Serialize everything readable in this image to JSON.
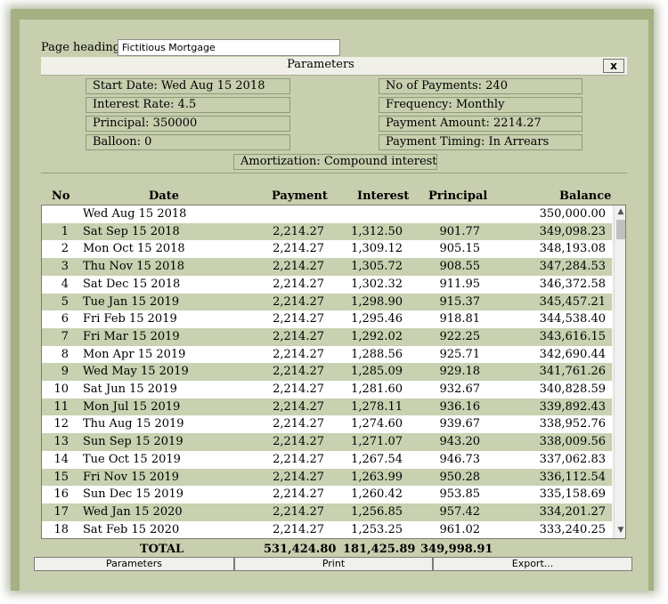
{
  "heading": {
    "label": "Page heading:",
    "value": "Fictitious Mortgage"
  },
  "parameters": {
    "title": "Parameters",
    "close_label": "x",
    "start_date": "Start Date: Wed Aug 15 2018",
    "interest_rate": "Interest Rate: 4.5",
    "principal": "Principal: 350000",
    "balloon": "Balloon: 0",
    "num_payments": "No of Payments: 240",
    "frequency": "Frequency: Monthly",
    "payment_amount": "Payment Amount: 2214.27",
    "payment_timing": "Payment Timing: In Arrears",
    "amortization": "Amortization: Compound interest"
  },
  "table": {
    "headers": {
      "no": "No",
      "date": "Date",
      "payment": "Payment",
      "interest": "Interest",
      "principal": "Principal",
      "balance": "Balance"
    },
    "rows": [
      {
        "no": "",
        "date": "Wed Aug 15 2018",
        "payment": "",
        "interest": "",
        "principal": "",
        "balance": "350,000.00"
      },
      {
        "no": "1",
        "date": "Sat Sep 15 2018",
        "payment": "2,214.27",
        "interest": "1,312.50",
        "principal": "901.77",
        "balance": "349,098.23"
      },
      {
        "no": "2",
        "date": "Mon Oct 15 2018",
        "payment": "2,214.27",
        "interest": "1,309.12",
        "principal": "905.15",
        "balance": "348,193.08"
      },
      {
        "no": "3",
        "date": "Thu Nov 15 2018",
        "payment": "2,214.27",
        "interest": "1,305.72",
        "principal": "908.55",
        "balance": "347,284.53"
      },
      {
        "no": "4",
        "date": "Sat Dec 15 2018",
        "payment": "2,214.27",
        "interest": "1,302.32",
        "principal": "911.95",
        "balance": "346,372.58"
      },
      {
        "no": "5",
        "date": "Tue Jan 15 2019",
        "payment": "2,214.27",
        "interest": "1,298.90",
        "principal": "915.37",
        "balance": "345,457.21"
      },
      {
        "no": "6",
        "date": "Fri Feb 15 2019",
        "payment": "2,214.27",
        "interest": "1,295.46",
        "principal": "918.81",
        "balance": "344,538.40"
      },
      {
        "no": "7",
        "date": "Fri Mar 15 2019",
        "payment": "2,214.27",
        "interest": "1,292.02",
        "principal": "922.25",
        "balance": "343,616.15"
      },
      {
        "no": "8",
        "date": "Mon Apr 15 2019",
        "payment": "2,214.27",
        "interest": "1,288.56",
        "principal": "925.71",
        "balance": "342,690.44"
      },
      {
        "no": "9",
        "date": "Wed May 15 2019",
        "payment": "2,214.27",
        "interest": "1,285.09",
        "principal": "929.18",
        "balance": "341,761.26"
      },
      {
        "no": "10",
        "date": "Sat Jun 15 2019",
        "payment": "2,214.27",
        "interest": "1,281.60",
        "principal": "932.67",
        "balance": "340,828.59"
      },
      {
        "no": "11",
        "date": "Mon Jul 15 2019",
        "payment": "2,214.27",
        "interest": "1,278.11",
        "principal": "936.16",
        "balance": "339,892.43"
      },
      {
        "no": "12",
        "date": "Thu Aug 15 2019",
        "payment": "2,214.27",
        "interest": "1,274.60",
        "principal": "939.67",
        "balance": "338,952.76"
      },
      {
        "no": "13",
        "date": "Sun Sep 15 2019",
        "payment": "2,214.27",
        "interest": "1,271.07",
        "principal": "943.20",
        "balance": "338,009.56"
      },
      {
        "no": "14",
        "date": "Tue Oct 15 2019",
        "payment": "2,214.27",
        "interest": "1,267.54",
        "principal": "946.73",
        "balance": "337,062.83"
      },
      {
        "no": "15",
        "date": "Fri Nov 15 2019",
        "payment": "2,214.27",
        "interest": "1,263.99",
        "principal": "950.28",
        "balance": "336,112.54"
      },
      {
        "no": "16",
        "date": "Sun Dec 15 2019",
        "payment": "2,214.27",
        "interest": "1,260.42",
        "principal": "953.85",
        "balance": "335,158.69"
      },
      {
        "no": "17",
        "date": "Wed Jan 15 2020",
        "payment": "2,214.27",
        "interest": "1,256.85",
        "principal": "957.42",
        "balance": "334,201.27"
      },
      {
        "no": "18",
        "date": "Sat Feb 15 2020",
        "payment": "2,214.27",
        "interest": "1,253.25",
        "principal": "961.02",
        "balance": "333,240.25"
      }
    ]
  },
  "totals": {
    "label": "TOTAL",
    "payment": "531,424.80",
    "interest": "181,425.89",
    "principal": "349,998.91"
  },
  "buttons": {
    "parameters": "Parameters",
    "print": "Print",
    "export": "Export..."
  },
  "scrollbar": {
    "up_icon": "▲",
    "down_icon": "▼"
  },
  "colors": {
    "frame": "#a5b083",
    "panel": "#c7cfae",
    "row_even": "#c8d1b0",
    "row_odd": "#ffffff"
  }
}
